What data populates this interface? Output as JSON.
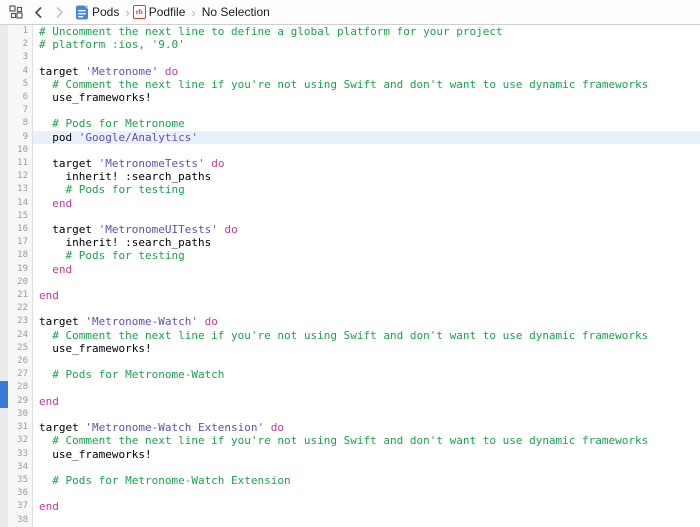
{
  "jumpbar": {
    "pods_label": "Pods",
    "podfile_label": "Podfile",
    "selection_label": "No Selection",
    "separator": "›",
    "rb_icon_text": "rb"
  },
  "colors": {
    "comment": "#1ca24e",
    "string": "#5f4fb2",
    "keyword": "#bf3a9d",
    "selection": "#e8f1fb",
    "changebar": "#3a7bd5",
    "line_number": "#9b9b9b",
    "code_text": "#000000",
    "file_icon_blue": "#3f87e0",
    "podfile_icon_red": "#cb4335"
  },
  "code": {
    "lines": [
      {
        "n": 1,
        "selected": false,
        "changed": false,
        "segs": [
          [
            "comment",
            "# Uncomment the next line to define a global platform for your project"
          ]
        ]
      },
      {
        "n": 2,
        "selected": false,
        "changed": false,
        "segs": [
          [
            "comment",
            "# platform :ios, '9.0'"
          ]
        ]
      },
      {
        "n": 3,
        "selected": false,
        "changed": false,
        "segs": []
      },
      {
        "n": 4,
        "selected": false,
        "changed": false,
        "segs": [
          [
            "plain",
            "target "
          ],
          [
            "string",
            "'Metronome'"
          ],
          [
            "plain",
            " "
          ],
          [
            "keyword",
            "do"
          ]
        ]
      },
      {
        "n": 5,
        "selected": false,
        "changed": false,
        "segs": [
          [
            "comment",
            "  # Comment the next line if you're not using Swift and don't want to use dynamic frameworks"
          ]
        ]
      },
      {
        "n": 6,
        "selected": false,
        "changed": false,
        "segs": [
          [
            "plain",
            "  use_frameworks!"
          ]
        ]
      },
      {
        "n": 7,
        "selected": false,
        "changed": false,
        "segs": []
      },
      {
        "n": 8,
        "selected": false,
        "changed": false,
        "segs": [
          [
            "comment",
            "  # Pods for Metronome"
          ]
        ]
      },
      {
        "n": 9,
        "selected": true,
        "changed": false,
        "segs": [
          [
            "plain",
            "  pod "
          ],
          [
            "string",
            "'Google/Analytics'"
          ]
        ]
      },
      {
        "n": 10,
        "selected": false,
        "changed": false,
        "segs": []
      },
      {
        "n": 11,
        "selected": false,
        "changed": false,
        "segs": [
          [
            "plain",
            "  target "
          ],
          [
            "string",
            "'MetronomeTests'"
          ],
          [
            "plain",
            " "
          ],
          [
            "keyword",
            "do"
          ]
        ]
      },
      {
        "n": 12,
        "selected": false,
        "changed": false,
        "segs": [
          [
            "plain",
            "    inherit! :search_paths"
          ]
        ]
      },
      {
        "n": 13,
        "selected": false,
        "changed": false,
        "segs": [
          [
            "comment",
            "    # Pods for testing"
          ]
        ]
      },
      {
        "n": 14,
        "selected": false,
        "changed": false,
        "segs": [
          [
            "plain",
            "  "
          ],
          [
            "keyword",
            "end"
          ]
        ]
      },
      {
        "n": 15,
        "selected": false,
        "changed": false,
        "segs": []
      },
      {
        "n": 16,
        "selected": false,
        "changed": false,
        "segs": [
          [
            "plain",
            "  target "
          ],
          [
            "string",
            "'MetronomeUITests'"
          ],
          [
            "plain",
            " "
          ],
          [
            "keyword",
            "do"
          ]
        ]
      },
      {
        "n": 17,
        "selected": false,
        "changed": false,
        "segs": [
          [
            "plain",
            "    inherit! :search_paths"
          ]
        ]
      },
      {
        "n": 18,
        "selected": false,
        "changed": false,
        "segs": [
          [
            "comment",
            "    # Pods for testing"
          ]
        ]
      },
      {
        "n": 19,
        "selected": false,
        "changed": false,
        "segs": [
          [
            "plain",
            "  "
          ],
          [
            "keyword",
            "end"
          ]
        ]
      },
      {
        "n": 20,
        "selected": false,
        "changed": false,
        "segs": []
      },
      {
        "n": 21,
        "selected": false,
        "changed": false,
        "segs": [
          [
            "keyword",
            "end"
          ]
        ]
      },
      {
        "n": 22,
        "selected": false,
        "changed": false,
        "segs": []
      },
      {
        "n": 23,
        "selected": false,
        "changed": false,
        "segs": [
          [
            "plain",
            "target "
          ],
          [
            "string",
            "'Metronome-Watch'"
          ],
          [
            "plain",
            " "
          ],
          [
            "keyword",
            "do"
          ]
        ]
      },
      {
        "n": 24,
        "selected": false,
        "changed": false,
        "segs": [
          [
            "comment",
            "  # Comment the next line if you're not using Swift and don't want to use dynamic frameworks"
          ]
        ]
      },
      {
        "n": 25,
        "selected": false,
        "changed": false,
        "segs": [
          [
            "plain",
            "  use_frameworks!"
          ]
        ]
      },
      {
        "n": 26,
        "selected": false,
        "changed": false,
        "segs": []
      },
      {
        "n": 27,
        "selected": false,
        "changed": false,
        "segs": [
          [
            "comment",
            "  # Pods for Metronome-Watch"
          ]
        ]
      },
      {
        "n": 28,
        "selected": false,
        "changed": true,
        "segs": []
      },
      {
        "n": 29,
        "selected": false,
        "changed": true,
        "segs": [
          [
            "keyword",
            "end"
          ]
        ]
      },
      {
        "n": 30,
        "selected": false,
        "changed": false,
        "segs": []
      },
      {
        "n": 31,
        "selected": false,
        "changed": false,
        "segs": [
          [
            "plain",
            "target "
          ],
          [
            "string",
            "'Metronome-Watch Extension'"
          ],
          [
            "plain",
            " "
          ],
          [
            "keyword",
            "do"
          ]
        ]
      },
      {
        "n": 32,
        "selected": false,
        "changed": false,
        "segs": [
          [
            "comment",
            "  # Comment the next line if you're not using Swift and don't want to use dynamic frameworks"
          ]
        ]
      },
      {
        "n": 33,
        "selected": false,
        "changed": false,
        "segs": [
          [
            "plain",
            "  use_frameworks!"
          ]
        ]
      },
      {
        "n": 34,
        "selected": false,
        "changed": false,
        "segs": []
      },
      {
        "n": 35,
        "selected": false,
        "changed": false,
        "segs": [
          [
            "comment",
            "  # Pods for Metronome-Watch Extension"
          ]
        ]
      },
      {
        "n": 36,
        "selected": false,
        "changed": false,
        "segs": []
      },
      {
        "n": 37,
        "selected": false,
        "changed": false,
        "segs": [
          [
            "keyword",
            "end"
          ]
        ]
      },
      {
        "n": 38,
        "selected": false,
        "changed": false,
        "segs": []
      }
    ]
  }
}
